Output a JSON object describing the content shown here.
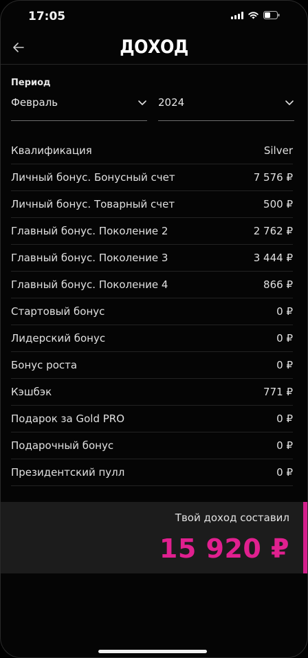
{
  "status_bar": {
    "time": "17:05"
  },
  "header": {
    "title": "ДОХОД"
  },
  "period": {
    "label": "Период",
    "month": "Февраль",
    "year": "2024"
  },
  "rows": [
    {
      "label": "Квалификация",
      "value": "Silver"
    },
    {
      "label": "Личный бонус. Бонусный счет",
      "value": "7 576 ₽"
    },
    {
      "label": "Личный бонус. Товарный счет",
      "value": "500 ₽"
    },
    {
      "label": "Главный бонус. Поколение 2",
      "value": "2 762 ₽"
    },
    {
      "label": "Главный бонус. Поколение 3",
      "value": "3 444 ₽"
    },
    {
      "label": "Главный бонус. Поколение 4",
      "value": "866 ₽"
    },
    {
      "label": "Стартовый бонус",
      "value": "0 ₽"
    },
    {
      "label": "Лидерский бонус",
      "value": "0 ₽"
    },
    {
      "label": "Бонус роста",
      "value": "0 ₽"
    },
    {
      "label": "Кэшбэк",
      "value": "771 ₽"
    },
    {
      "label": "Подарок за Gold PRO",
      "value": "0 ₽"
    },
    {
      "label": "Подарочный бонус",
      "value": "0 ₽"
    },
    {
      "label": "Президентский пулл",
      "value": "0 ₽"
    }
  ],
  "total": {
    "label": "Твой доход составил",
    "value": "15 920 ₽"
  },
  "colors": {
    "background": "#050505",
    "accent": "#e0208f",
    "panel": "#1c1c1c"
  },
  "icons": {
    "back": "arrow-left-icon",
    "dropdown": "chevron-down-icon",
    "signal": "cellular-signal-icon",
    "wifi": "wifi-icon",
    "battery": "battery-icon"
  }
}
